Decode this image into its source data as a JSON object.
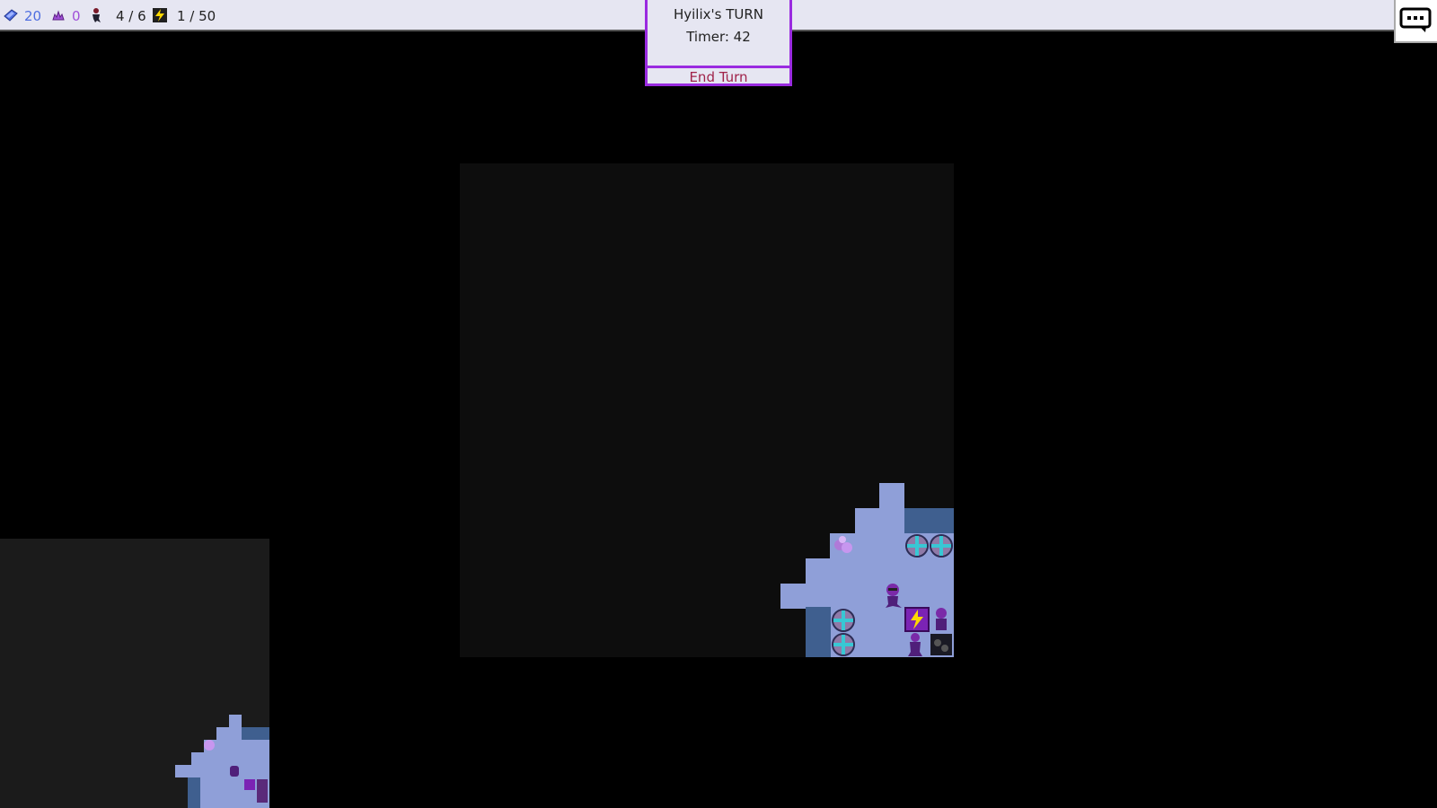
{
  "hud": {
    "crystals": "20",
    "essence": "0",
    "units": "4 / 6",
    "energy": "1 / 50",
    "colors": {
      "crystals": "#4f6ee0",
      "essence": "#a050d8",
      "text": "#222222"
    }
  },
  "turn": {
    "player_turn": "Hyilix's TURN",
    "timer": "Timer: 42",
    "end_turn": "End Turn"
  },
  "icons": {
    "crystal": "crystal-icon",
    "essence": "essence-icon",
    "unit": "unit-icon",
    "energy": "energy-icon",
    "chat": "chat-icon"
  }
}
